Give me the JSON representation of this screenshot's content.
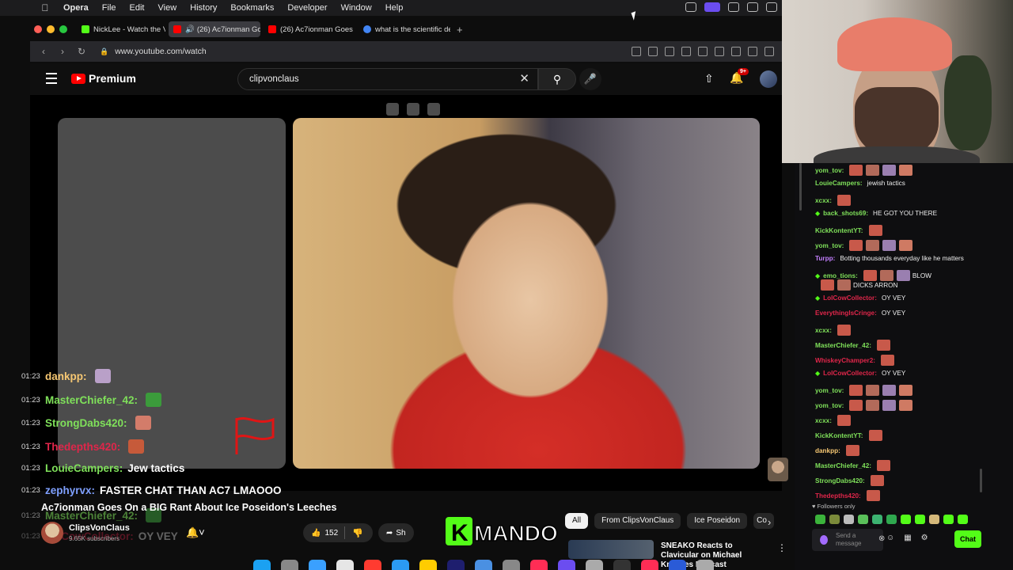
{
  "menubar": {
    "app": "Opera",
    "items": [
      "File",
      "Edit",
      "View",
      "History",
      "Bookmarks",
      "Developer",
      "Window",
      "Help"
    ]
  },
  "tabs": [
    {
      "label": "NickLee - Watch the VO",
      "color": "#53fc18"
    },
    {
      "label": "(26) Ac7ionman Goes O",
      "color": "#ff0000"
    },
    {
      "label": "(26) Ac7ionman Goes O",
      "color": "#ff0000"
    },
    {
      "label": "what is the scientific de",
      "color": "#4285f4"
    }
  ],
  "address": {
    "url": "www.youtube.com/watch"
  },
  "youtube": {
    "logo": "Premium",
    "search_value": "clipvonclaus",
    "notification_count": "9+"
  },
  "overlay_chat": [
    {
      "time": "01:23",
      "user": "dankpp:",
      "msg": "",
      "color": "#f7c873",
      "emote": "#b9a0c8"
    },
    {
      "time": "01:23",
      "user": "MasterChiefer_42:",
      "msg": "",
      "color": "#7fe05a",
      "emote": "#3b9b3b"
    },
    {
      "time": "01:23",
      "user": "StrongDabs420:",
      "msg": "",
      "color": "#7fe05a",
      "emote": "#d37c6a"
    },
    {
      "time": "01:23",
      "user": "Thedepths420:",
      "msg": "",
      "color": "#e0264a",
      "emote": "#c65a3a"
    },
    {
      "time": "01:23",
      "user": "LouieCampers:",
      "msg": "Jew tactics",
      "color": "#7fe05a",
      "emote": ""
    },
    {
      "time": "01:23",
      "user": "zephyrvx:",
      "msg": "FASTER CHAT THAN AC7 LMAOOO",
      "color": "#7fa0ff",
      "emote": ""
    },
    {
      "time": "01:23",
      "user": "MasterChiefer_42:",
      "msg": "",
      "color": "#7fe05a",
      "emote": "#3b9b3b"
    },
    {
      "time": "01:23",
      "user": "LolCowCollector:",
      "msg": "OY VEY",
      "color": "#e0264a",
      "emote": ""
    }
  ],
  "video": {
    "title": "Ac7ionman Goes On a BIG Rant About Ice Poseidon's Leeches",
    "channel": "ClipsVonClaus",
    "subscribers": "9.65K subscribers",
    "likes": "152",
    "share": "Sh",
    "overlay_brand": "MANDO",
    "overlay_brand_k": "K"
  },
  "chips": [
    "All",
    "From ClipsVonClaus",
    "Ice Poseidon",
    "Co"
  ],
  "recommendation": {
    "title": "SNEAKO Reacts to Clavicular on Michael Knowles Podcast"
  },
  "side_chat": [
    {
      "user": "yom_tov:",
      "msg": "",
      "color": "#7fe05a",
      "emotes": 4,
      "diamond": false
    },
    {
      "user": "LouieCampers:",
      "msg": "jewish tactics",
      "color": "#7fe05a",
      "emotes": 0,
      "diamond": false
    },
    {
      "user": "xcxx:",
      "msg": "",
      "color": "#7fe05a",
      "emotes": 1,
      "diamond": false
    },
    {
      "user": "back_shots69:",
      "msg": "HE GOT YOU THERE",
      "color": "#7fe05a",
      "emotes": 0,
      "diamond": true
    },
    {
      "user": "KickKontentYT:",
      "msg": "",
      "color": "#7fe05a",
      "emotes": 1,
      "diamond": false
    },
    {
      "user": "yom_tov:",
      "msg": "",
      "color": "#7fe05a",
      "emotes": 4,
      "diamond": false
    },
    {
      "user": "Turpp:",
      "msg": "Botting thousands everyday like he matters",
      "color": "#c37fff",
      "emotes": 0,
      "diamond": false
    },
    {
      "user": "emo_tions:",
      "msg": "BLOW",
      "color": "#7fe05a",
      "emotes": 3,
      "diamond": true
    },
    {
      "user": "",
      "msg": "DICKS ARRON",
      "color": "#7fe05a",
      "emotes": 2,
      "diamond": false
    },
    {
      "user": "LolCowCollector:",
      "msg": "OY VEY",
      "color": "#e0264a",
      "emotes": 0,
      "diamond": true
    },
    {
      "user": "EverythingIsCringe:",
      "msg": "OY VEY",
      "color": "#e0264a",
      "emotes": 0,
      "diamond": false
    },
    {
      "user": "xcxx:",
      "msg": "",
      "color": "#7fe05a",
      "emotes": 1,
      "diamond": false
    },
    {
      "user": "MasterChiefer_42:",
      "msg": "",
      "color": "#7fe05a",
      "emotes": 1,
      "diamond": false
    },
    {
      "user": "WhiskeyChamper2:",
      "msg": "",
      "color": "#e0264a",
      "emotes": 1,
      "diamond": false
    },
    {
      "user": "LolCowCollector:",
      "msg": "OY VEY",
      "color": "#e0264a",
      "emotes": 0,
      "diamond": true
    },
    {
      "user": "yom_tov:",
      "msg": "",
      "color": "#7fe05a",
      "emotes": 4,
      "diamond": false
    },
    {
      "user": "yom_tov:",
      "msg": "",
      "color": "#7fe05a",
      "emotes": 4,
      "diamond": false
    },
    {
      "user": "xcxx:",
      "msg": "",
      "color": "#7fe05a",
      "emotes": 1,
      "diamond": false
    },
    {
      "user": "KickKontentYT:",
      "msg": "",
      "color": "#7fe05a",
      "emotes": 1,
      "diamond": false
    },
    {
      "user": "dankpp:",
      "msg": "",
      "color": "#f7c873",
      "emotes": 1,
      "diamond": false
    },
    {
      "user": "MasterChiefer_42:",
      "msg": "",
      "color": "#7fe05a",
      "emotes": 1,
      "diamond": false
    },
    {
      "user": "StrongDabs420:",
      "msg": "",
      "color": "#7fe05a",
      "emotes": 1,
      "diamond": false
    },
    {
      "user": "Thedepths420:",
      "msg": "",
      "color": "#e0264a",
      "emotes": 1,
      "diamond": false
    }
  ],
  "chat_footer": {
    "followers_only": "Followers only",
    "input_placeholder": "Send a message",
    "chat_button": "Chat"
  },
  "colors": {
    "kick_green": "#53fc18",
    "youtube_red": "#ff0000",
    "opera_purple": "#6b4df0"
  }
}
